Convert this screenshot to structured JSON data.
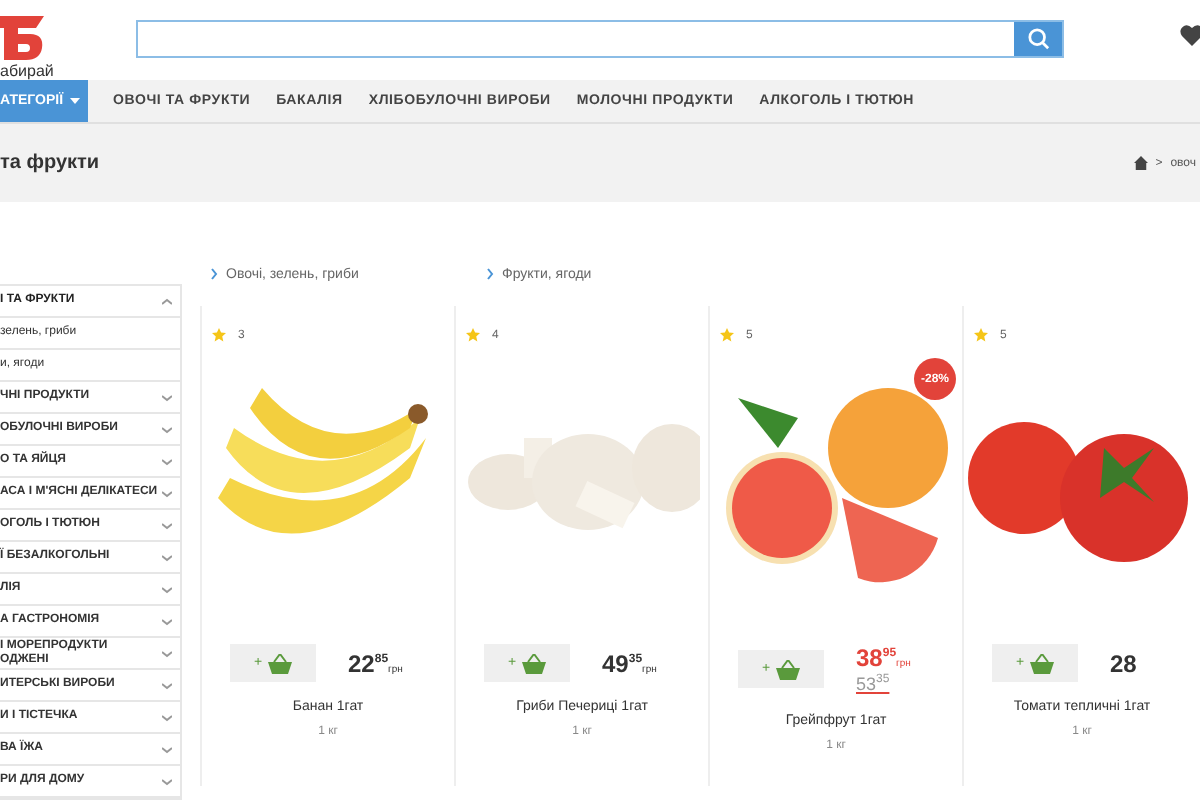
{
  "header": {
    "logo_text": "абирай"
  },
  "nav": {
    "categories_button": "АТЕГОРІЇ",
    "items": [
      "ОВОЧІ ТА ФРУКТИ",
      "БАКАЛІЯ",
      "ХЛІБОБУЛОЧНІ ВИРОБИ",
      "МОЛОЧНІ ПРОДУКТИ",
      "АЛКОГОЛЬ І ТЮТЮН"
    ]
  },
  "page_title": "та фрукти",
  "breadcrumb": {
    "separator": ">",
    "current": "овоч"
  },
  "sidebar": {
    "items": [
      {
        "label": "І ТА ФРУКТИ",
        "expanded": true,
        "children": [
          {
            "label": "зелень, гриби"
          },
          {
            "label": "и, ягоди"
          }
        ]
      },
      {
        "label": "ЧНІ ПРОДУКТИ",
        "expanded": false
      },
      {
        "label": "ОБУЛОЧНІ ВИРОБИ",
        "expanded": false
      },
      {
        "label": "О ТА ЯЙЦЯ",
        "expanded": false
      },
      {
        "label": "АСА І М'ЯСНІ ДЕЛІКАТЕСИ",
        "expanded": false
      },
      {
        "label": "ОГОЛЬ І ТЮТЮН",
        "expanded": false
      },
      {
        "label": "Ї БЕЗАЛКОГОЛЬНІ",
        "expanded": false
      },
      {
        "label": "ЛІЯ",
        "expanded": false
      },
      {
        "label": "А ГАСТРОНОМІЯ",
        "expanded": false
      },
      {
        "label": "І МОРЕПРОДУКТИ\nОДЖЕНІ",
        "expanded": false
      },
      {
        "label": "ИТЕРСЬКІ ВИРОБИ",
        "expanded": false
      },
      {
        "label": "И І ТІСТЕЧКА",
        "expanded": false
      },
      {
        "label": "ВА ЇЖА",
        "expanded": false
      },
      {
        "label": "РИ ДЛЯ ДОМУ",
        "expanded": false
      }
    ]
  },
  "subcategories": [
    "Овочі, зелень, гриби",
    "Фрукти, ягоди"
  ],
  "products": [
    {
      "kind": "banana",
      "rating": "3",
      "add_label": "+",
      "price": {
        "main": "22",
        "cents": "85",
        "currency": "грн"
      },
      "name": "Банан 1гат",
      "unit": "1 кг"
    },
    {
      "kind": "mushroom",
      "rating": "4",
      "add_label": "+",
      "price": {
        "main": "49",
        "cents": "35",
        "currency": "грн"
      },
      "name": "Гриби Печериці 1гат",
      "unit": "1 кг"
    },
    {
      "kind": "grapefruit",
      "rating": "5",
      "add_label": "+",
      "discount": "-28%",
      "price": {
        "main": "38",
        "cents": "95",
        "currency": "грн"
      },
      "old_price": {
        "main": "53",
        "cents": "35"
      },
      "name": "Грейпфрут 1гат",
      "unit": "1 кг"
    },
    {
      "kind": "tomato",
      "rating": "5",
      "add_label": "+",
      "price": {
        "main": "28"
      },
      "name": "Томати тепличні 1гат",
      "unit": "1 кг"
    }
  ]
}
